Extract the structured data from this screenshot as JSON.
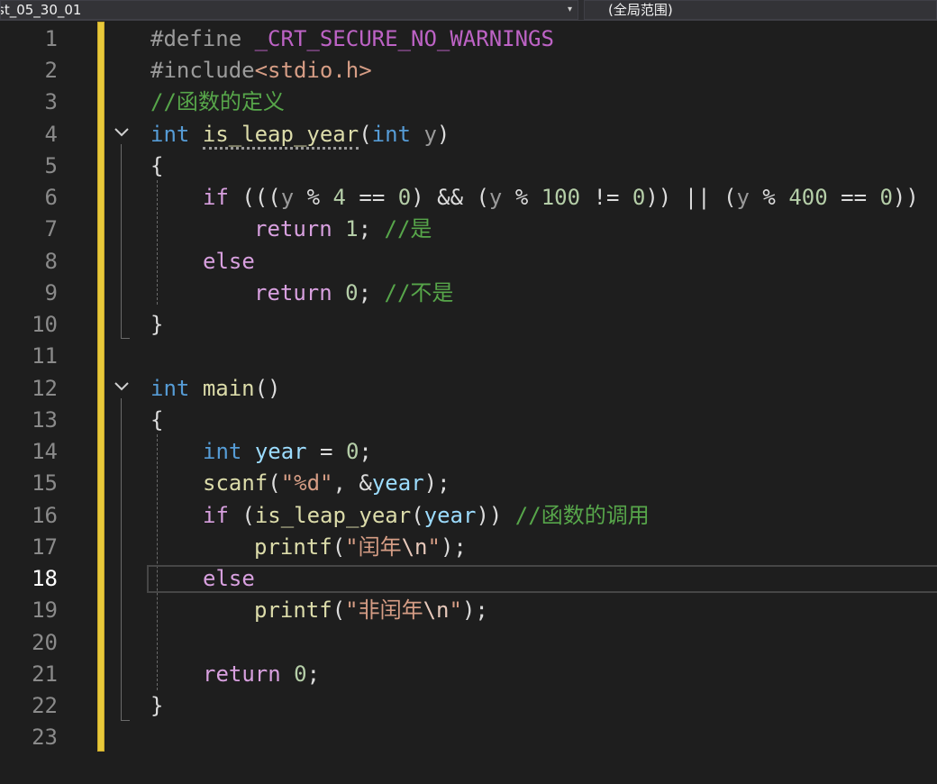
{
  "toolbar": {
    "file_scope": "st_05_30_01",
    "global_scope": "(全局范围)",
    "dropdown_arrow": "▾"
  },
  "editor": {
    "current_line": 18,
    "line_numbers": [
      "1",
      "2",
      "3",
      "4",
      "5",
      "6",
      "7",
      "8",
      "9",
      "10",
      "11",
      "12",
      "13",
      "14",
      "15",
      "16",
      "17",
      "18",
      "19",
      "20",
      "21",
      "22",
      "23"
    ],
    "lines": {
      "l1": [
        "#define",
        " ",
        "_CRT_SECURE_NO_WARNINGS"
      ],
      "l2": [
        "#include",
        "<stdio.h>"
      ],
      "l3": [
        "//函数的定义"
      ],
      "l4": [
        "int",
        " ",
        "is_leap_year",
        "(",
        "int",
        " ",
        "y",
        ")"
      ],
      "l5": [
        "{"
      ],
      "l6": [
        "if",
        " (((",
        "y",
        " % ",
        "4",
        " == ",
        "0",
        ") && (",
        "y",
        " % ",
        "100",
        " != ",
        "0",
        ")) || (",
        "y",
        " % ",
        "400",
        " == ",
        "0",
        "))"
      ],
      "l7": [
        "return",
        " ",
        "1",
        ";",
        " //是"
      ],
      "l8": [
        "else"
      ],
      "l9": [
        "return",
        " ",
        "0",
        ";",
        " //不是"
      ],
      "l10": [
        "}"
      ],
      "l12": [
        "int",
        " ",
        "main",
        "()"
      ],
      "l13": [
        "{"
      ],
      "l14": [
        "int",
        " ",
        "year",
        " = ",
        "0",
        ";"
      ],
      "l15": [
        "scanf",
        "(",
        "\"%d\"",
        ", &",
        "year",
        ");"
      ],
      "l16": [
        "if",
        " (",
        "is_leap_year",
        "(",
        "year",
        "))",
        " //函数的调用"
      ],
      "l17": [
        "printf",
        "(",
        "\"闰年",
        "\\n",
        "\"",
        ");"
      ],
      "l18": [
        "else"
      ],
      "l19": [
        "printf",
        "(",
        "\"非闰年",
        "\\n",
        "\"",
        ");"
      ],
      "l21": [
        "return",
        " ",
        "0",
        ";"
      ],
      "l22": [
        "}"
      ]
    }
  },
  "colors": {
    "background": "#1e1e1e",
    "keyword": "#569cd6",
    "control": "#d8a0df",
    "function": "#dcdcaa",
    "comment": "#57a64a",
    "string": "#d69d85",
    "number": "#b5cea8",
    "variable": "#9cdcfe",
    "change_bar": "#e8c93a"
  }
}
